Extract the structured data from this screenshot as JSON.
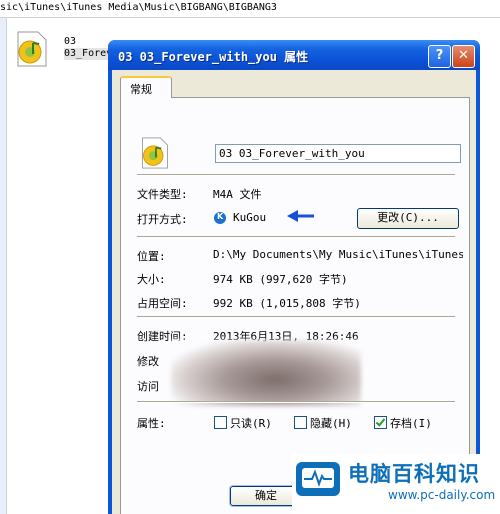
{
  "explorer": {
    "address_path": "sic\\iTunes\\iTunes Media\\Music\\BIGBANG\\BIGBANG3",
    "file_line1": "03",
    "file_line2": "03_Forev"
  },
  "dialog": {
    "title": "03 03_Forever_with_you 属性",
    "help_label": "?",
    "close_label": "✕",
    "tab_general": "常规",
    "file_name": "03 03_Forever_with_you",
    "rows": {
      "type_label": "文件类型:",
      "type_value": "M4A 文件",
      "open_with_label": "打开方式:",
      "open_with_value": "KuGou",
      "change_button": "更改(C)...",
      "location_label": "位置:",
      "location_value": "D:\\My Documents\\My Music\\iTunes\\iTunes Me",
      "size_label": "大小:",
      "size_value": "974 KB (997,620 字节)",
      "disk_size_label": "占用空间:",
      "disk_size_value": "992 KB (1,015,808 字节)",
      "created_label": "创建时间:",
      "created_value": "2013年6月13日, 18:26:46",
      "modified_label": "修改",
      "accessed_label": "访问",
      "attributes_label": "属性:"
    },
    "attributes": {
      "readonly": "只读(R)",
      "hidden": "隐藏(H)",
      "archive": "存档(I)",
      "readonly_checked": false,
      "hidden_checked": false,
      "archive_checked": true
    },
    "ok_button": "确定"
  },
  "watermark": {
    "title": "电脑百科知识",
    "url": "www.pc-daily.com"
  },
  "colors": {
    "titlebar": "#0b50d6",
    "dialog_face": "#ece9d8",
    "annotation_arrow": "#1a4fd8",
    "watermark": "#0e6fb8"
  },
  "icons": [
    "music-file-icon",
    "kugou-icon",
    "help-icon",
    "close-icon",
    "blue-arrow-icon",
    "pc-daily-logo-icon"
  ]
}
